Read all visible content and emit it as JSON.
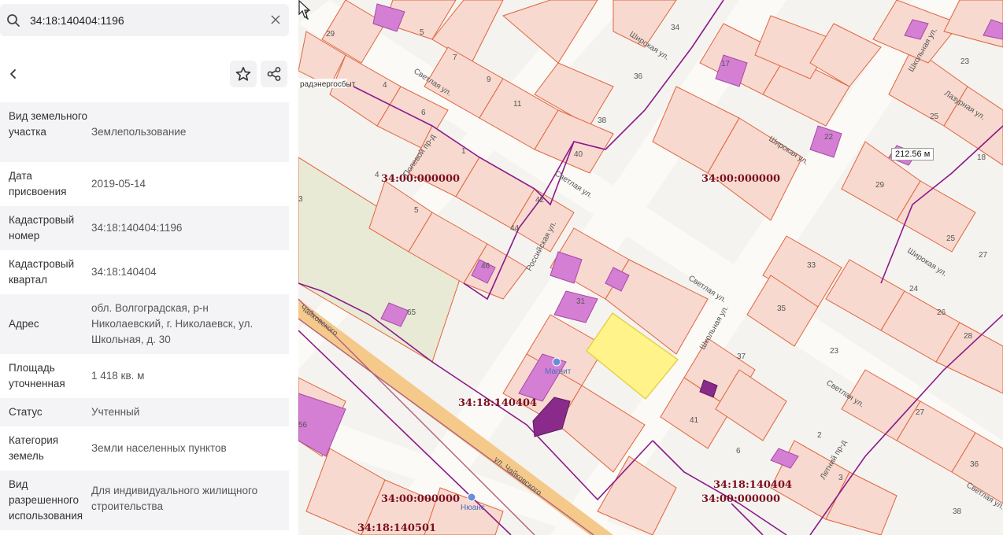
{
  "search": {
    "value": "34:18:140404:1196"
  },
  "icons": {
    "search": "search-icon",
    "clear": "close-icon",
    "back": "chevron-left-icon",
    "favorite": "star-icon",
    "share": "share-icon",
    "collapse": "chevron-left-icon"
  },
  "properties": [
    {
      "key": "Вид земельного участка",
      "value": "Землепользование"
    },
    {
      "key": "Дата присвоения",
      "value": "2019-05-14"
    },
    {
      "key": "Кадастровый номер",
      "value": "34:18:140404:1196"
    },
    {
      "key": "Кадастровый квартал",
      "value": "34:18:140404"
    },
    {
      "key": "Адрес",
      "value": "обл. Волгоградская, р-н Николаевский, г. Николаевск, ул. Школьная, д. 30"
    },
    {
      "key": "Площадь уточненная",
      "value": "1 418 кв. м"
    },
    {
      "key": "Статус",
      "value": "Учтенный"
    },
    {
      "key": "Категория земель",
      "value": "Земли населенных пунктов"
    },
    {
      "key": "Вид разрешенного использования",
      "value": "Для индивидуального жилищного строительства"
    }
  ],
  "map": {
    "measure_label": "212.56 м",
    "quarter_labels": [
      "34:00:000000",
      "34:00:000000",
      "34:18:140404",
      "34:18:140404",
      "34:00:000000",
      "34:00:000000",
      "34:18:140501"
    ],
    "street_labels": [
      "Широкая ул.",
      "Светлая ул.",
      "Полевой пр-д",
      "Российская ул.",
      "Светлая ул.",
      "Широкая ул.",
      "Школьная ул.",
      "Лазурная ул.",
      "Широкая ул.",
      "Светлая ул.",
      "Школьная ул.",
      "Светлая ул.",
      "Летний пр-д",
      "Светлая ул.",
      "ул. Чайковского",
      "Чайковского"
    ],
    "plot_numbers": [
      "29",
      "5",
      "7",
      "4",
      "6",
      "9",
      "11",
      "36",
      "38",
      "40",
      "34",
      "17",
      "1",
      "42",
      "44",
      "46",
      "5",
      "4",
      "3",
      "31",
      "25",
      "22",
      "29",
      "23",
      "25",
      "27",
      "18",
      "33",
      "35",
      "24",
      "26",
      "28",
      "23",
      "37",
      "41",
      "6",
      "2",
      "27",
      "3",
      "36",
      "38",
      "56",
      "65"
    ],
    "poi_labels": [
      "Магнит",
      "Нюанс",
      "радэнергосбыт"
    ],
    "colors": {
      "parcel_fill": "#f7d9cf",
      "parcel_stroke": "#e0643c",
      "quarter_border": "#8a1a8a",
      "building": "#d47fd4",
      "selected": "#fff38a",
      "road": "#f5c98a"
    }
  }
}
